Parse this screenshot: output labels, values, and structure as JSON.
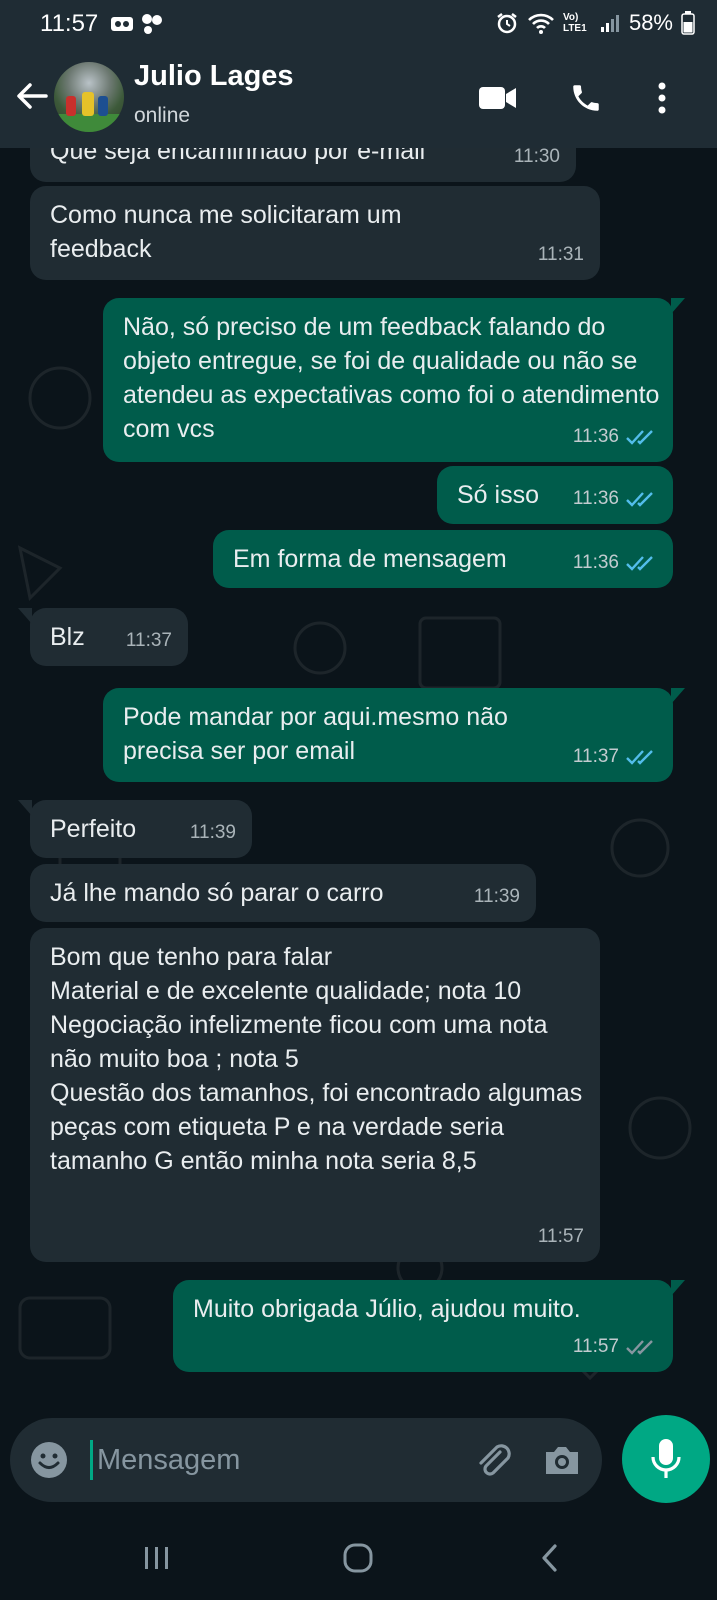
{
  "status_bar": {
    "time": "11:57",
    "battery": "58%",
    "network": "Vo) LTE1",
    "icons": [
      "vr-icon",
      "cast-icon",
      "alarm-icon",
      "wifi-icon",
      "signal-icon",
      "battery-icon"
    ]
  },
  "header": {
    "contact_name": "Julio Lages",
    "contact_status": "online",
    "icons": [
      "back-arrow-icon",
      "video-call-icon",
      "phone-icon",
      "more-vert-icon"
    ]
  },
  "messages": [
    {
      "dir": "in",
      "text": "Que seja encaminhado por e-mail",
      "time": "11:30"
    },
    {
      "dir": "in",
      "text": "Como nunca me solicitaram um feedback",
      "time": "11:31"
    },
    {
      "dir": "out",
      "text": "Não, só preciso de um feedback falando do objeto entregue, se foi de qualidade ou não se atendeu as expectativas como foi o atendimento com vcs",
      "time": "11:36",
      "read": true
    },
    {
      "dir": "out",
      "text": "Só isso",
      "time": "11:36",
      "read": true
    },
    {
      "dir": "out",
      "text": "Em forma de mensagem",
      "time": "11:36",
      "read": true
    },
    {
      "dir": "in",
      "text": "Blz",
      "time": "11:37"
    },
    {
      "dir": "out",
      "text": "Pode mandar por aqui.mesmo não precisa ser por email",
      "time": "11:37",
      "read": true
    },
    {
      "dir": "in",
      "text": "Perfeito",
      "time": "11:39"
    },
    {
      "dir": "in",
      "text": "Já lhe mando só parar o carro",
      "time": "11:39"
    },
    {
      "dir": "in",
      "text": "Bom que tenho para falar\nMaterial e de excelente qualidade; nota 10\nNegociação infelizmente ficou com uma nota não muito boa ; nota 5\nQuestão dos tamanhos, foi encontrado algumas peças com etiqueta P e na verdade seria tamanho G então minha nota seria 8,5",
      "time": "11:57"
    },
    {
      "dir": "out",
      "text": "Muito obrigada Júlio, ajudou muito.",
      "time": "11:57",
      "read": false
    }
  ],
  "composer": {
    "placeholder": "Mensagem",
    "icons": [
      "emoji-icon",
      "attach-icon",
      "camera-icon",
      "mic-icon"
    ]
  },
  "nav_bar": {
    "icons": [
      "recents-icon",
      "home-icon",
      "back-icon"
    ]
  },
  "colors": {
    "background": "#0b141a",
    "header": "#1f2c34",
    "incoming_bubble": "#202c33",
    "outgoing_bubble": "#005c4b",
    "accent": "#00a884",
    "read_ticks": "#53bdeb",
    "sent_ticks": "#8696a0"
  }
}
